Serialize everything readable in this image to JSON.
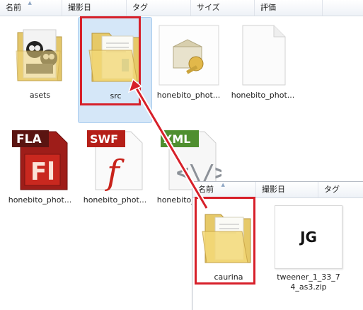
{
  "header": {
    "columns": [
      "名前",
      "撮影日",
      "タグ",
      "サイズ",
      "評価"
    ]
  },
  "files": [
    {
      "label": "asets",
      "icon": "image-folder-icon"
    },
    {
      "label": "src",
      "icon": "folder-icon"
    },
    {
      "label": "honebito_phot...",
      "icon": "certificate-file-icon"
    },
    {
      "label": "honebito_phot...",
      "icon": "blank-file-icon"
    },
    {
      "label": "honebito_phot...",
      "icon": "flash-fla-file-icon",
      "badge": "FLA",
      "glyph": "Fl"
    },
    {
      "label": "honebito_phot...",
      "icon": "flash-swf-file-icon",
      "badge": "SWF",
      "glyph": "f"
    },
    {
      "label": "honebito_phot...",
      "icon": "xml-file-icon",
      "badge": "XML",
      "glyph": "<\\/>"
    }
  ],
  "subwindow": {
    "columns": [
      "名前",
      "撮影日",
      "タグ"
    ],
    "files": [
      {
        "label": "caurina",
        "icon": "folder-icon"
      },
      {
        "label": "tweener_1_33_7 4_as3.zip",
        "icon": "jpeg-file-icon",
        "thumb_text": "JG"
      }
    ]
  },
  "colors": {
    "highlight": "#d7202a",
    "selection": "#d5e7f8"
  }
}
